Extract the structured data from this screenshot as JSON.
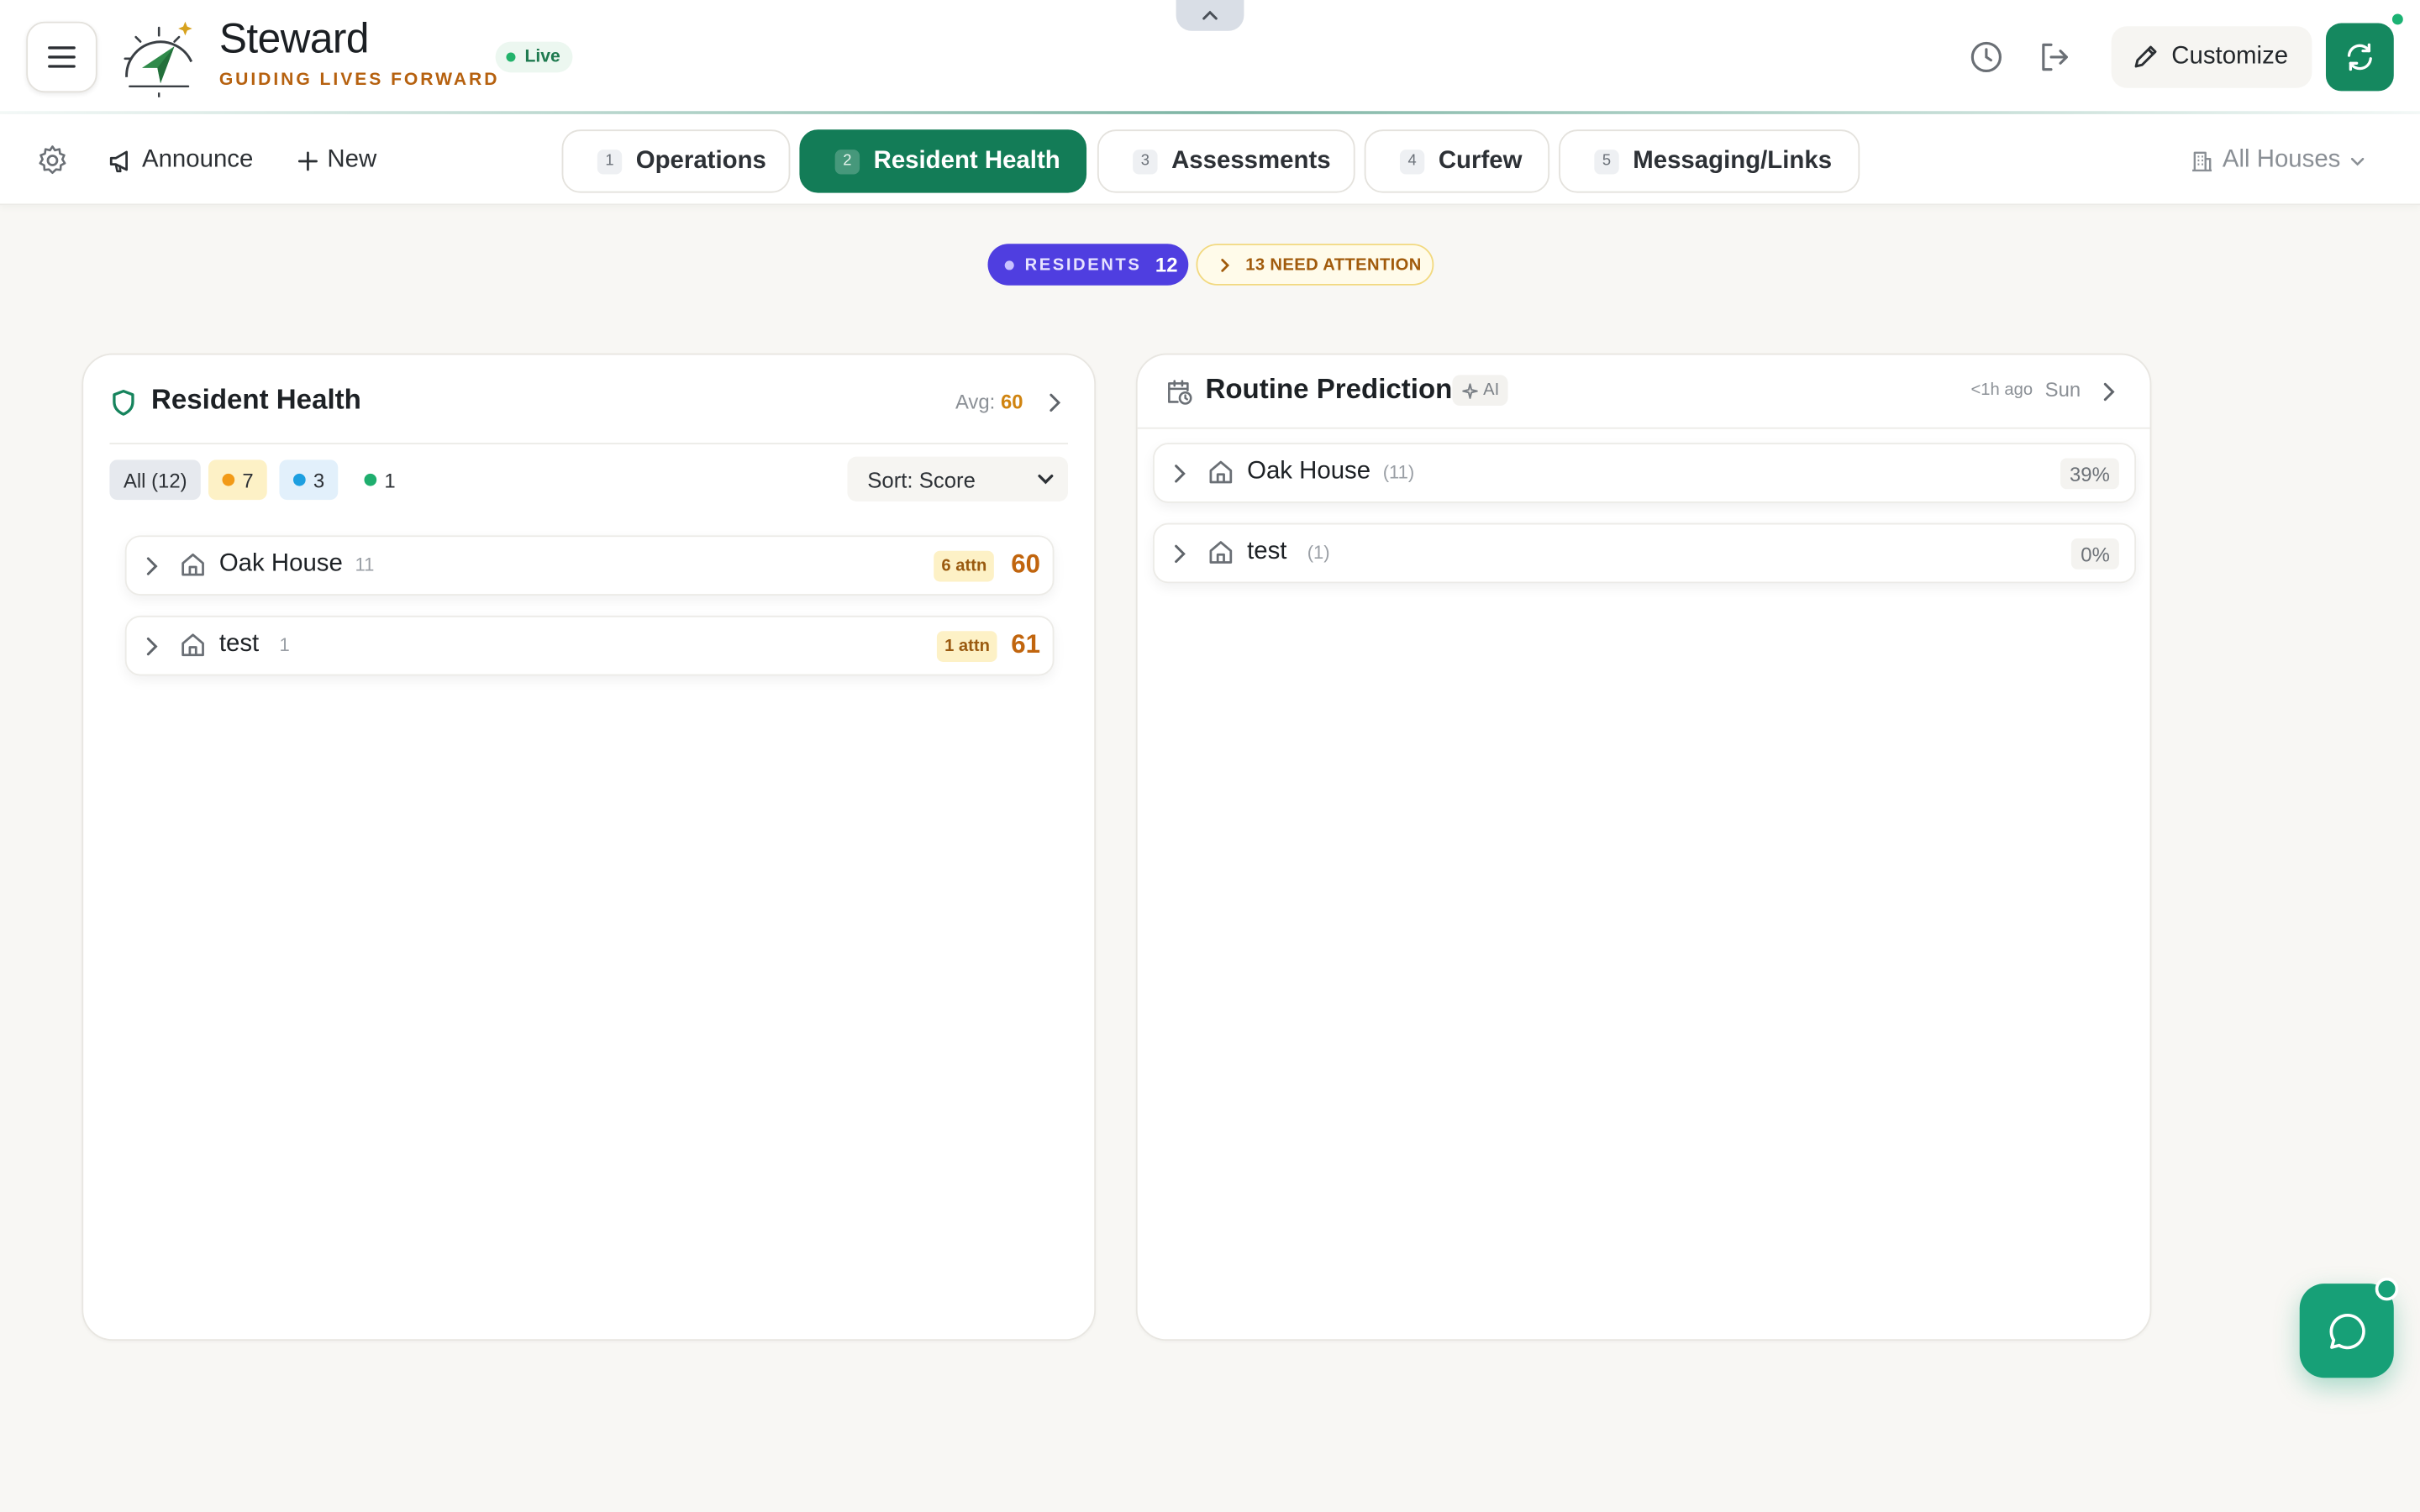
{
  "app": {
    "title": "Steward",
    "tagline": "GUIDING LIVES FORWARD",
    "status": "Live",
    "brand_color": "#137c57",
    "accent_color": "#b6610f"
  },
  "header": {
    "customize_label": "Customize",
    "icons": [
      "menu-icon",
      "history-icon",
      "logout-icon",
      "pencil-icon",
      "refresh-icon",
      "chevron-up-icon"
    ]
  },
  "toolbar": {
    "announce_label": "Announce",
    "new_label": "New",
    "houses_label": "All Houses",
    "tabs": [
      {
        "num": "1",
        "label": "Operations",
        "active": false
      },
      {
        "num": "2",
        "label": "Resident Health",
        "active": true
      },
      {
        "num": "3",
        "label": "Assessments",
        "active": false
      },
      {
        "num": "4",
        "label": "Curfew",
        "active": false
      },
      {
        "num": "5",
        "label": "Messaging/Links",
        "active": false
      }
    ]
  },
  "stats": {
    "residents_label": "RESIDENTS",
    "residents_count": "12",
    "attention_label": "13 NEED ATTENTION"
  },
  "health": {
    "title": "Resident Health",
    "avg_label": "Avg:",
    "avg_value": "60",
    "filters": {
      "all": "All (12)",
      "orange": "7",
      "blue": "3",
      "green": "1"
    },
    "sort_label": "Sort: Score",
    "rows": [
      {
        "name": "Oak House",
        "count": "11",
        "attn": "6 attn",
        "score": "60"
      },
      {
        "name": "test",
        "count": "1",
        "attn": "1 attn",
        "score": "61"
      }
    ]
  },
  "predictions": {
    "title": "Routine Predictions",
    "ai_label": "AI",
    "updated": "<1h ago",
    "day": "Sun",
    "rows": [
      {
        "name": "Oak House",
        "count": "(11)",
        "pct": "39%"
      },
      {
        "name": "test",
        "count": "(1)",
        "pct": "0%"
      }
    ]
  }
}
